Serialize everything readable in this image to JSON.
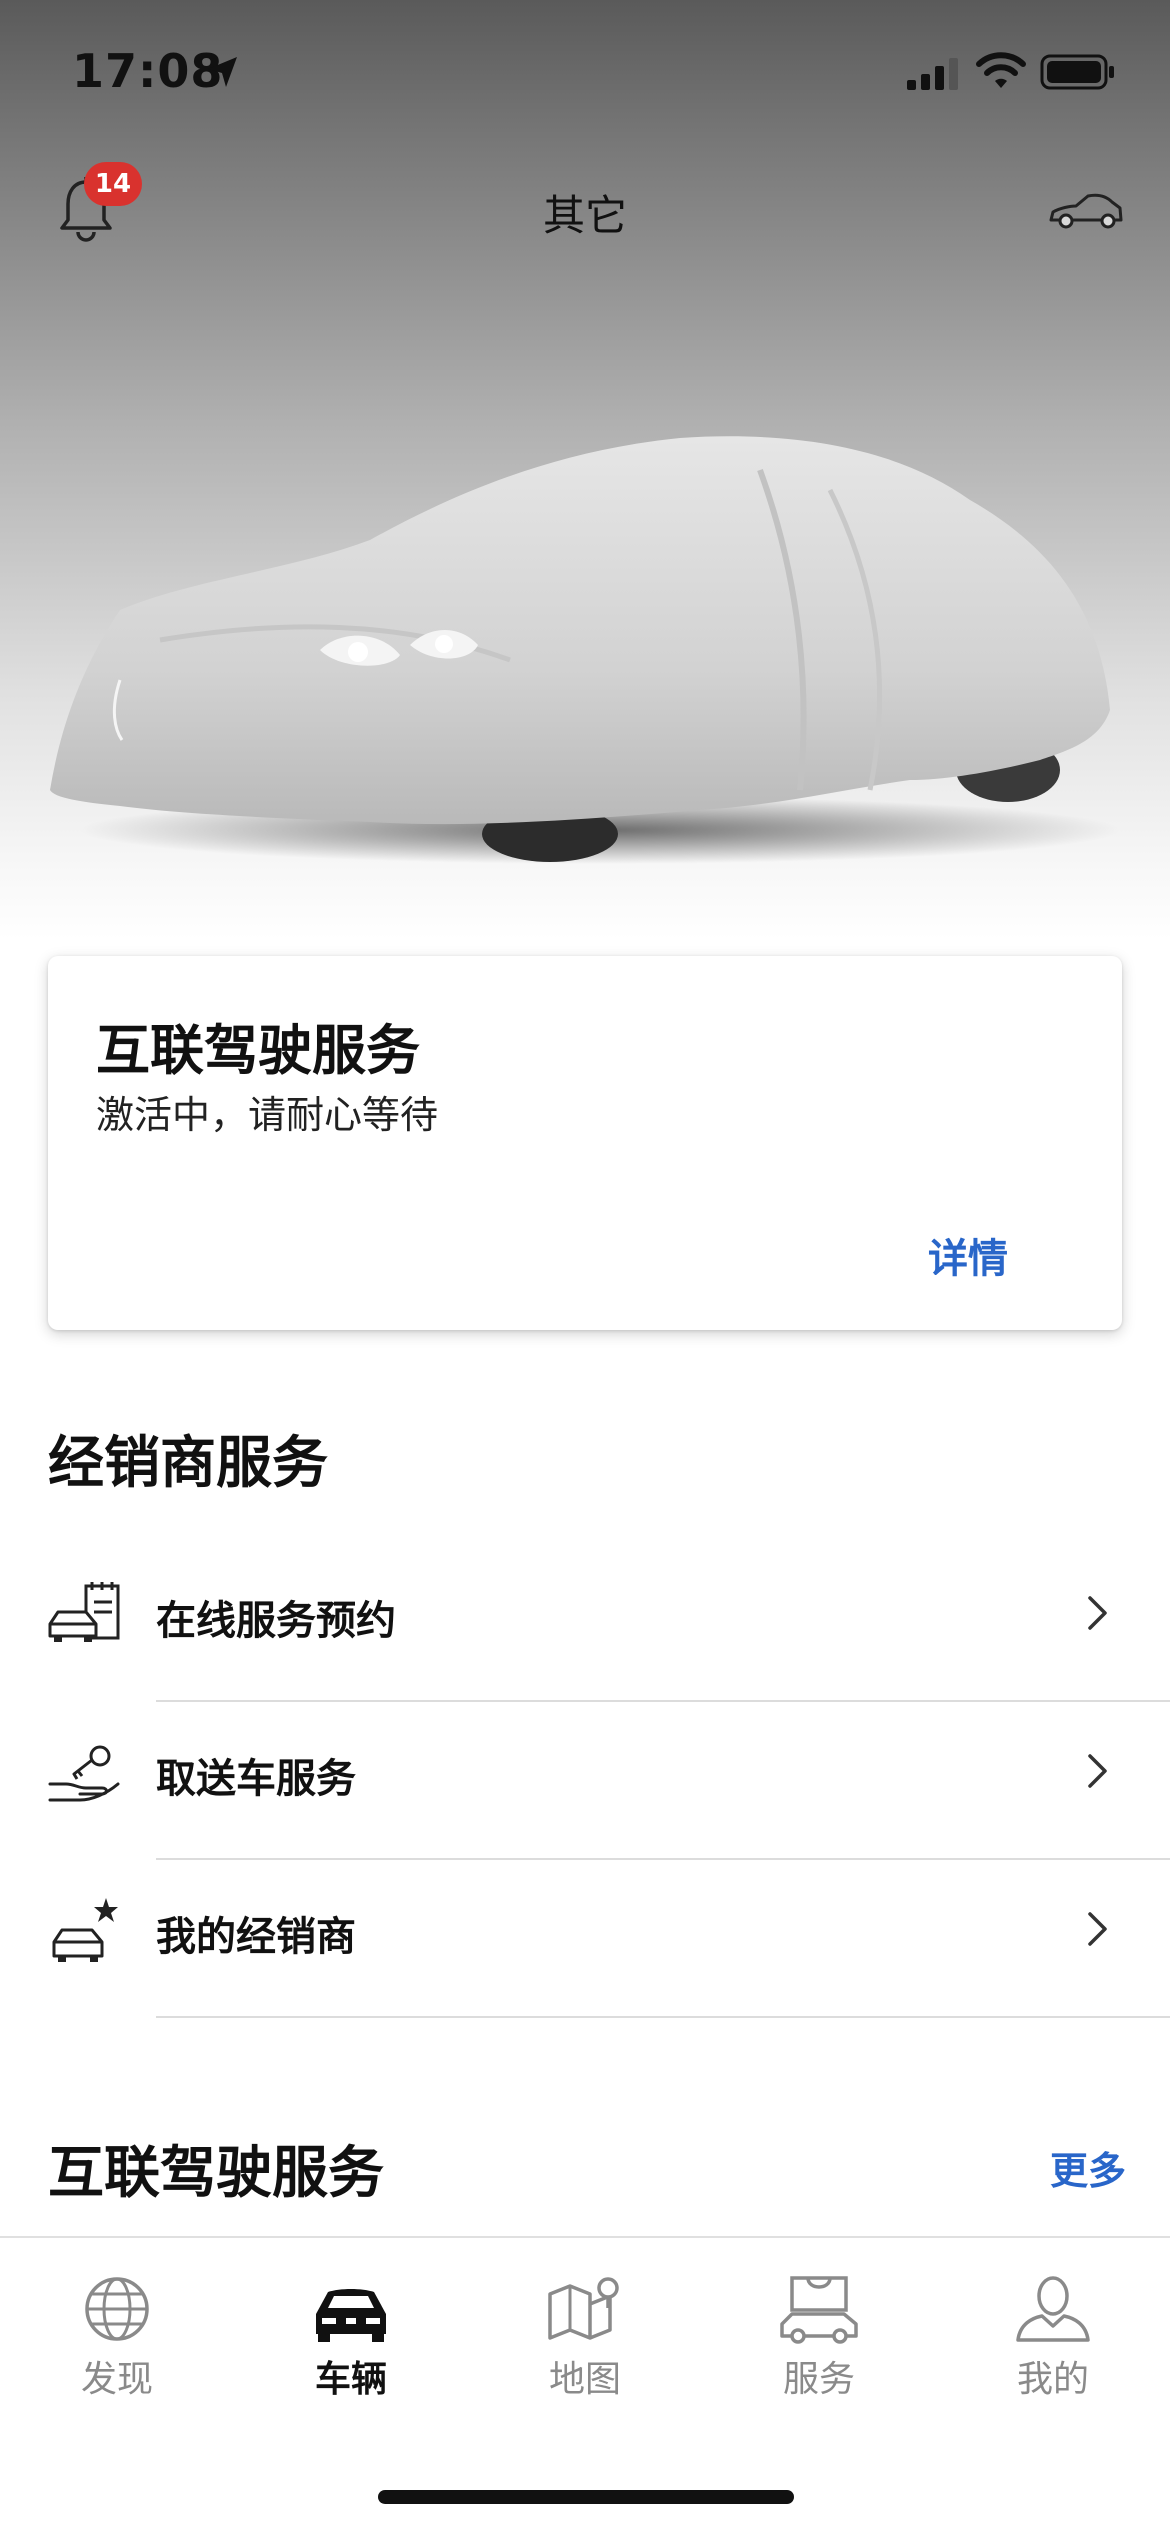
{
  "status_bar": {
    "time": "17:08"
  },
  "header": {
    "title": "其它",
    "notification_count": "14"
  },
  "connected_card": {
    "title": "互联驾驶服务",
    "subtitle": "激活中，请耐心等待",
    "details_label": "详情"
  },
  "dealer_section": {
    "title": "经销商服务",
    "items": [
      {
        "label": "在线服务预约",
        "icon": "car-calendar-icon"
      },
      {
        "label": "取送车服务",
        "icon": "hand-key-icon"
      },
      {
        "label": "我的经销商",
        "icon": "car-star-icon"
      }
    ]
  },
  "connected_section": {
    "title": "互联驾驶服务",
    "more_label": "更多"
  },
  "tabbar": {
    "tabs": [
      {
        "label": "发现",
        "icon": "globe-icon",
        "active": false
      },
      {
        "label": "车辆",
        "icon": "car-icon",
        "active": true
      },
      {
        "label": "地图",
        "icon": "map-icon",
        "active": false
      },
      {
        "label": "服务",
        "icon": "shopping-bag-car-icon",
        "active": false
      },
      {
        "label": "我的",
        "icon": "person-icon",
        "active": false
      }
    ]
  },
  "colors": {
    "accent": "#2966c9",
    "badge": "#d9322e"
  }
}
